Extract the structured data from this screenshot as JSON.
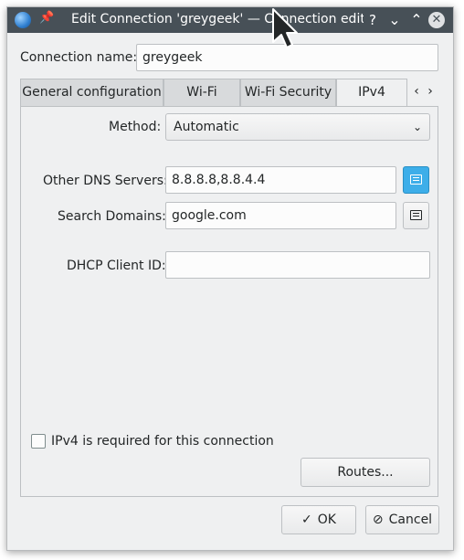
{
  "window": {
    "title": "Edit Connection 'greygeek' — Connection editor",
    "help_icon": "?",
    "minimize_icon": "⌄",
    "maximize_icon": "⌃",
    "close_icon": "✕"
  },
  "connection": {
    "name_label": "Connection name:",
    "name_value": "greygeek"
  },
  "tabs": [
    {
      "label": "General configuration"
    },
    {
      "label": "Wi-Fi"
    },
    {
      "label": "Wi-Fi Security"
    },
    {
      "label": "IPv4"
    }
  ],
  "tab_scroll": {
    "left": "‹",
    "right": "›"
  },
  "ipv4": {
    "method_label": "Method:",
    "method_value": "Automatic",
    "dns_label": "Other DNS Servers:",
    "dns_value": "8.8.8.8,8.8.4.4",
    "search_label": "Search Domains:",
    "search_value": "google.com",
    "dhcp_label": "DHCP Client ID:",
    "dhcp_value": "",
    "required_label": "IPv4 is required for this connection",
    "required_checked": false,
    "routes_label": "Routes..."
  },
  "footer": {
    "ok_icon": "✓",
    "ok_label": "OK",
    "cancel_icon": "⊘",
    "cancel_label": "Cancel"
  },
  "colors": {
    "titlebar": "#475057",
    "window_bg": "#eff0f1",
    "accent": "#3daee9"
  }
}
